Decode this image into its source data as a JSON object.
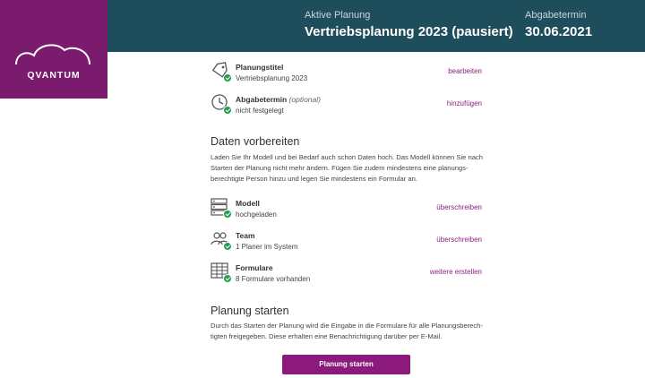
{
  "header": {
    "plan_label": "Aktive Planung",
    "plan_value": "Vertriebsplanung 2023 (pausiert)",
    "deadline_label": "Abgabetermin",
    "deadline_value": "30.06.2021"
  },
  "logo": {
    "text": "QVANTUM"
  },
  "settings": {
    "title_item": {
      "label": "Planungstitel",
      "value": "Vertriebsplanung 2023",
      "action": "bearbeiten"
    },
    "deadline_item": {
      "label": "Abgabetermin",
      "optional": "(optional)",
      "value": "nicht festgelegt",
      "action": "hinzufügen"
    }
  },
  "prepare": {
    "heading": "Daten vorbereiten",
    "description": "Laden Sie Ihr Modell und bei Bedarf auch schon Daten hoch. Das Modell können Sie nach Starten der Planung nicht mehr ändern. Fügen Sie zudem mindestens eine planungs-berechtigte Person hinzu und legen Sie mindestens ein Formular an.",
    "items": [
      {
        "label": "Modell",
        "value": "hochgeladen",
        "action": "überschreiben"
      },
      {
        "label": "Team",
        "value": "1 Planer im System",
        "action": "überschreiben"
      },
      {
        "label": "Formulare",
        "value": "8 Formulare vorhanden",
        "action": "weitere erstellen"
      }
    ]
  },
  "start": {
    "heading": "Planung starten",
    "description": "Durch das Starten der Planung wird die Eingabe in die Formulare für alle Planungsberech-tigten freigegeben. Diese erhalten eine Benachrichtigung darüber per E-Mail.",
    "button": "Planung starten"
  },
  "colors": {
    "header": "#1e4e5c",
    "brand": "#7a1b6e",
    "accent": "#8c1a7c",
    "success": "#23a04a"
  }
}
